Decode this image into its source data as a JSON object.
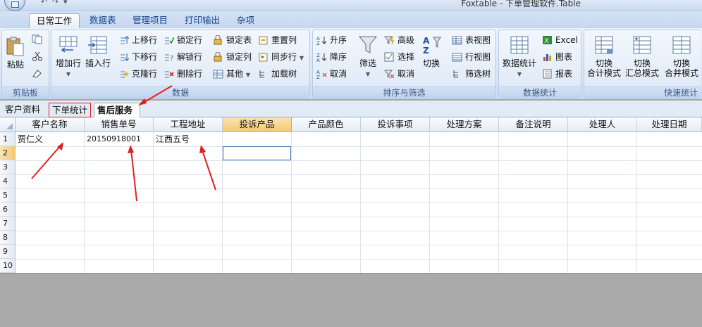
{
  "window": {
    "title": "Foxtable - 下单管理软件.Table",
    "quick_access": [
      "↶",
      "↷",
      "▾"
    ]
  },
  "ribbon_tabs": [
    "日常工作",
    "数据表",
    "管理项目",
    "打印输出",
    "杂项"
  ],
  "groups": {
    "clipboard": {
      "label": "剪贴板",
      "paste": "粘贴"
    },
    "data": {
      "label": "数据",
      "add_row": "增加行",
      "insert_row": "插入行",
      "move_up": "上移行",
      "move_down": "下移行",
      "clone_row": "克隆行",
      "lock_row": "锁定行",
      "unlock_row": "解锁行",
      "delete_row": "删除行",
      "lock_table": "锁定表",
      "lock_col": "锁定列",
      "other": "其他",
      "reset_col": "重置列",
      "sync_row": "同步行",
      "load_tree": "加载树"
    },
    "sort": {
      "label": "排序与筛选",
      "asc": "升序",
      "desc": "降序",
      "cancel_sort": "取消",
      "filter": "筛选",
      "advanced": "高级",
      "select": "选择",
      "cancel_filter": "取消",
      "toggle": "切换",
      "table_view": "表视图",
      "row_view": "行视图",
      "filter_tree": "筛选树"
    },
    "stats": {
      "label": "数据统计",
      "data_stats": "数据统计",
      "excel": "Excel",
      "chart": "图表",
      "report": "报表"
    },
    "quick": {
      "label": "快速统计",
      "b1": [
        "切换",
        "合计模式"
      ],
      "b2": [
        "切换",
        "汇总模式"
      ],
      "b3": [
        "切换",
        "合并模式"
      ]
    }
  },
  "sheet_tabs": [
    "客户资料",
    "下单统计",
    "售后服务"
  ],
  "columns": [
    "客户名称",
    "销售单号",
    "工程地址",
    "投诉产品",
    "产品颜色",
    "投诉事项",
    "处理方案",
    "备注说明",
    "处理人",
    "处理日期"
  ],
  "row_numbers": [
    "1",
    "2",
    "3",
    "4",
    "5",
    "6",
    "7",
    "8",
    "9",
    "10"
  ],
  "rows": [
    [
      "贾仁义",
      "20150918001",
      "江西五号",
      "",
      "",
      "",
      "",
      "",
      "",
      ""
    ]
  ],
  "colors": {
    "accent_red": "#e02020",
    "header_highlight": "#f3c873",
    "ribbon_text": "#15428b"
  }
}
